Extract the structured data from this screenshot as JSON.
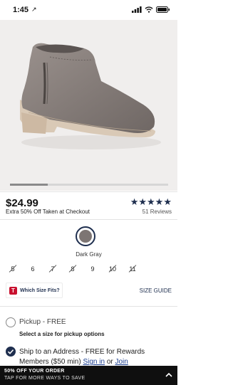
{
  "status_bar": {
    "time": "1:45",
    "location_glyph": "↗"
  },
  "product": {
    "price": "$24.99",
    "promo": "Extra 50% Off Taken at Checkout",
    "rating_stars": "★★★★★",
    "rating_value": 5,
    "reviews": "51 Reviews",
    "carousel_progress": 0.24
  },
  "color": {
    "name": "Dark Gray",
    "hex": "#7d7573"
  },
  "sizes": [
    {
      "label": "5",
      "available": false
    },
    {
      "label": "6",
      "available": true
    },
    {
      "label": "7",
      "available": false
    },
    {
      "label": "8",
      "available": false
    },
    {
      "label": "9",
      "available": true
    },
    {
      "label": "10",
      "available": false
    },
    {
      "label": "11",
      "available": false
    }
  ],
  "fit": {
    "badge": "T",
    "label": "Which Size Fits?",
    "size_guide": "SIZE GUIDE"
  },
  "fulfillment": {
    "pickup": {
      "label": "Pickup - FREE",
      "note": "Select a size for pickup options",
      "selected": false
    },
    "ship": {
      "label_prefix": "Ship to an Address - FREE for Rewards Members ($50 min) ",
      "signin": "Sign in",
      "or": " or ",
      "join": "Join",
      "selected": true
    }
  },
  "promo_bar": {
    "line1": "50% OFF YOUR ORDER",
    "line2": "TAP FOR MORE WAYS TO SAVE"
  },
  "colors": {
    "accent": "#1f2f4f",
    "brand_red": "#c8102e",
    "link": "#1a3d8f"
  }
}
